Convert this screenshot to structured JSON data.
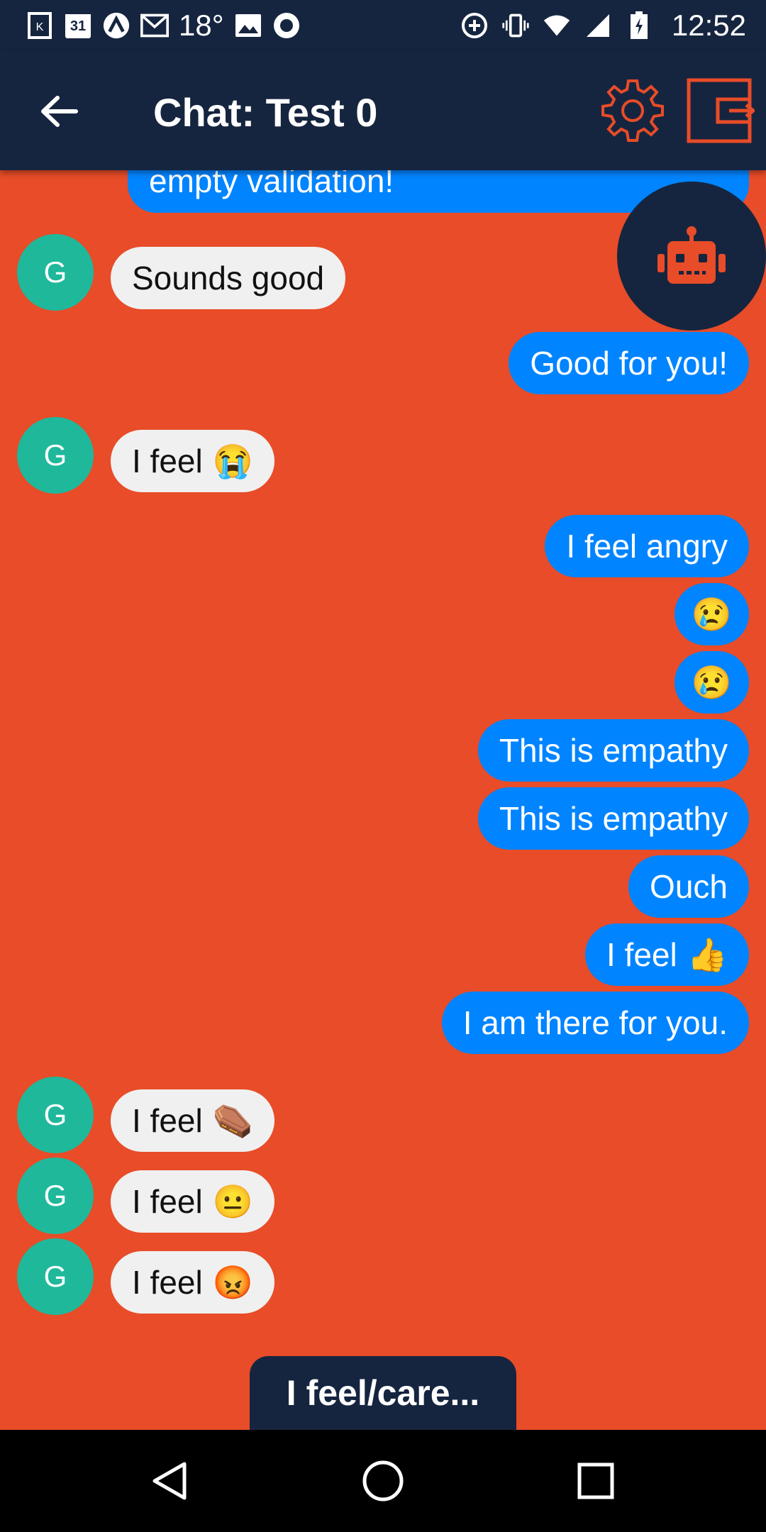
{
  "status_bar": {
    "calendar_day": "31",
    "temperature": "18°",
    "time": "12:52",
    "icons_left": [
      "k-app-icon",
      "calendar-icon",
      "app-logo-icon",
      "gmail-icon",
      "image-icon",
      "record-icon"
    ],
    "icons_right": [
      "data-saver-icon",
      "vibrate-icon",
      "wifi-icon",
      "signal-icon",
      "battery-charging-icon"
    ]
  },
  "app_bar": {
    "title": "Chat: Test 0",
    "back_icon": "arrow-left-icon",
    "settings_icon": "gear-icon",
    "exit_icon": "logout-icon"
  },
  "colors": {
    "background": "#e84c28",
    "navy": "#16253f",
    "user_bubble": "#0084ff",
    "other_bubble": "#f0f0f0",
    "avatar": "#1fb89b"
  },
  "messages": [
    {
      "side": "user",
      "text": "empty validation!",
      "emoji": ""
    },
    {
      "side": "other",
      "avatar": "G",
      "text": "Sounds good",
      "emoji": ""
    },
    {
      "side": "user",
      "text": "Good for you!",
      "emoji": ""
    },
    {
      "side": "other",
      "avatar": "G",
      "text": "I feel",
      "emoji": "😭"
    },
    {
      "side": "user",
      "text": "I feel angry",
      "emoji": ""
    },
    {
      "side": "user",
      "text": "",
      "emoji": "😢"
    },
    {
      "side": "user",
      "text": "",
      "emoji": "😢"
    },
    {
      "side": "user",
      "text": "This is empathy",
      "emoji": ""
    },
    {
      "side": "user",
      "text": "This is empathy",
      "emoji": ""
    },
    {
      "side": "user",
      "text": "Ouch",
      "emoji": ""
    },
    {
      "side": "user",
      "text": "I feel",
      "emoji": "👍"
    },
    {
      "side": "user",
      "text": "I am there for you.",
      "emoji": ""
    },
    {
      "side": "other",
      "avatar": "G",
      "text": "I feel",
      "emoji": "⚰️"
    },
    {
      "side": "other",
      "avatar": "G",
      "text": "I feel",
      "emoji": "😐"
    },
    {
      "side": "other",
      "avatar": "G",
      "text": "I feel",
      "emoji": "😡"
    }
  ],
  "bot_fab": {
    "icon": "robot-icon"
  },
  "bottom_action": {
    "label": "I feel/care..."
  },
  "nav_bar": {
    "back_icon": "nav-back-icon",
    "home_icon": "nav-home-icon",
    "recents_icon": "nav-recents-icon"
  }
}
